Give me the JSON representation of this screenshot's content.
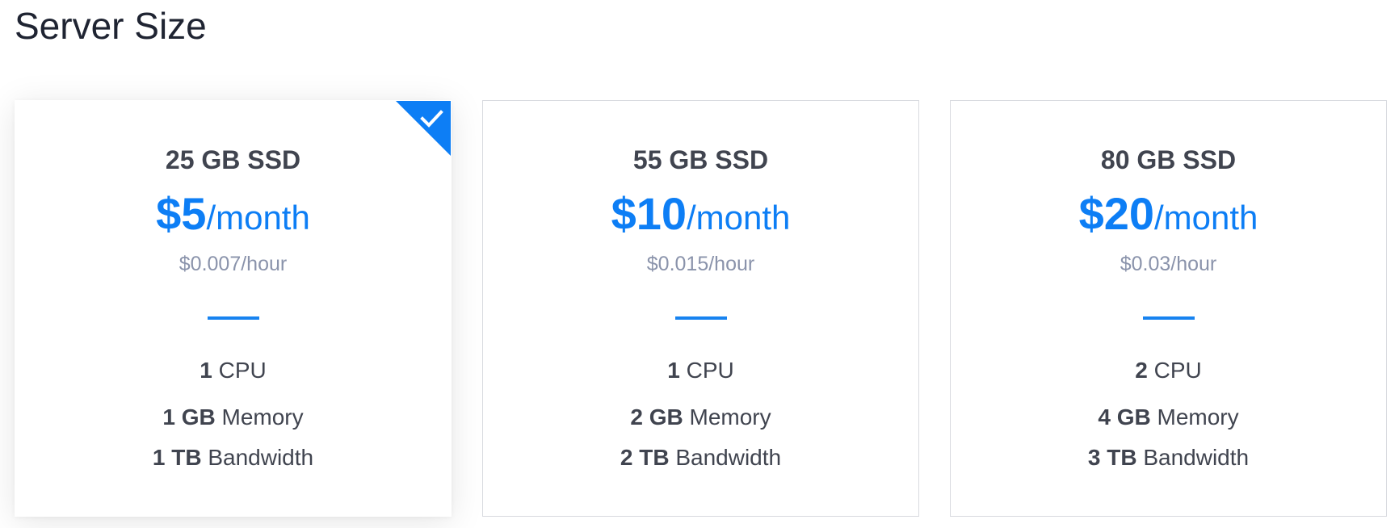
{
  "page": {
    "title": "Server Size"
  },
  "colors": {
    "accent": "#0d7ef5",
    "hourly_text": "#8a93ab",
    "card_border": "#d8dadf"
  },
  "plans": [
    {
      "storage": "25 GB SSD",
      "price_amount": "$5",
      "price_period": "/month",
      "hourly": "$0.007/hour",
      "cpu_value": "1",
      "cpu_label": "CPU",
      "memory_value": "1 GB",
      "memory_label": "Memory",
      "bandwidth_value": "1 TB",
      "bandwidth_label": "Bandwidth",
      "selected": true,
      "selected_icon": "checkmark-icon"
    },
    {
      "storage": "55 GB SSD",
      "price_amount": "$10",
      "price_period": "/month",
      "hourly": "$0.015/hour",
      "cpu_value": "1",
      "cpu_label": "CPU",
      "memory_value": "2 GB",
      "memory_label": "Memory",
      "bandwidth_value": "2 TB",
      "bandwidth_label": "Bandwidth",
      "selected": false
    },
    {
      "storage": "80 GB SSD",
      "price_amount": "$20",
      "price_period": "/month",
      "hourly": "$0.03/hour",
      "cpu_value": "2",
      "cpu_label": "CPU",
      "memory_value": "4 GB",
      "memory_label": "Memory",
      "bandwidth_value": "3 TB",
      "bandwidth_label": "Bandwidth",
      "selected": false
    }
  ]
}
